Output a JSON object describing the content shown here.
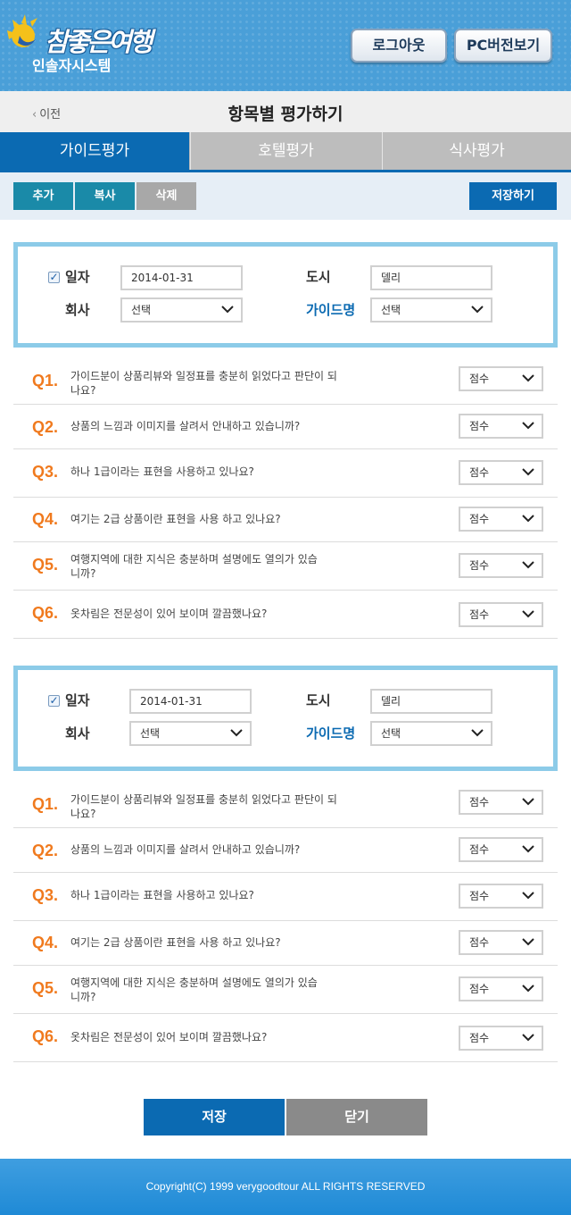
{
  "header": {
    "logo_script": "참좋은여행",
    "logo_sub": "인솔자시스템",
    "logout_label": "로그아웃",
    "pc_version_label": "PC버전보기"
  },
  "titlebar": {
    "back_label": "이전",
    "title": "항목별 평가하기"
  },
  "tabs": [
    {
      "label": "가이드평가",
      "active": true
    },
    {
      "label": "호텔평가",
      "active": false
    },
    {
      "label": "식사평가",
      "active": false
    }
  ],
  "actions": {
    "add_label": "추가",
    "copy_label": "복사",
    "delete_label": "삭제",
    "save_label": "저장하기"
  },
  "evaluations": [
    {
      "checked": true,
      "date_label": "일자",
      "date_value": "2014-01-31",
      "city_label": "도시",
      "city_value": "델리",
      "company_label": "회사",
      "company_value": "선택",
      "guide_label": "가이드명",
      "guide_value": "선택",
      "questions": [
        {
          "num": "Q1.",
          "text": "가이드분이 상품리뷰와 일정표를 충분히 읽었다고 판단이 되나요?",
          "score": "점수"
        },
        {
          "num": "Q2.",
          "text": "상품의 느낌과 이미지를 살려서 안내하고 있습니까?",
          "score": "점수"
        },
        {
          "num": "Q3.",
          "text": "하나 1급이라는 표현을 사용하고 있나요?",
          "score": "점수"
        },
        {
          "num": "Q4.",
          "text": "여기는 2급 상품이란 표현을 사용 하고 있나요?",
          "score": "점수"
        },
        {
          "num": "Q5.",
          "text": "여행지역에 대한 지식은 충분하며 설명에도 열의가 있습니까?",
          "score": "점수"
        },
        {
          "num": "Q6.",
          "text": "옷차림은 전문성이 있어 보이며 깔끔했나요?",
          "score": "점수"
        }
      ]
    },
    {
      "checked": true,
      "date_label": "일자",
      "date_value": "2014-01-31",
      "city_label": "도시",
      "city_value": "델리",
      "company_label": "회사",
      "company_value": "선택",
      "guide_label": "가이드명",
      "guide_value": "선택",
      "questions": [
        {
          "num": "Q1.",
          "text": "가이드분이 상품리뷰와 일정표를 충분히 읽었다고 판단이 되나요?",
          "score": "점수"
        },
        {
          "num": "Q2.",
          "text": "상품의 느낌과 이미지를 살려서 안내하고 있습니까?",
          "score": "점수"
        },
        {
          "num": "Q3.",
          "text": "하나 1급이라는 표현을 사용하고 있나요?",
          "score": "점수"
        },
        {
          "num": "Q4.",
          "text": "여기는 2급 상품이란 표현을 사용 하고 있나요?",
          "score": "점수"
        },
        {
          "num": "Q5.",
          "text": "여행지역에 대한 지식은 충분하며 설명에도 열의가 있습니까?",
          "score": "점수"
        },
        {
          "num": "Q6.",
          "text": "옷차림은 전문성이 있어 보이며 깔끔했나요?",
          "score": "점수"
        }
      ]
    }
  ],
  "bottom": {
    "save_label": "저장",
    "close_label": "닫기"
  },
  "footer": {
    "copyright": "Copyright(C) 1999 verygoodtour ALL RIGHTS RESERVED"
  },
  "colors": {
    "primary": "#0b6ab2",
    "teal": "#1a8aa8",
    "question_number": "#f07a1e",
    "box_border": "#8ccbe8"
  }
}
